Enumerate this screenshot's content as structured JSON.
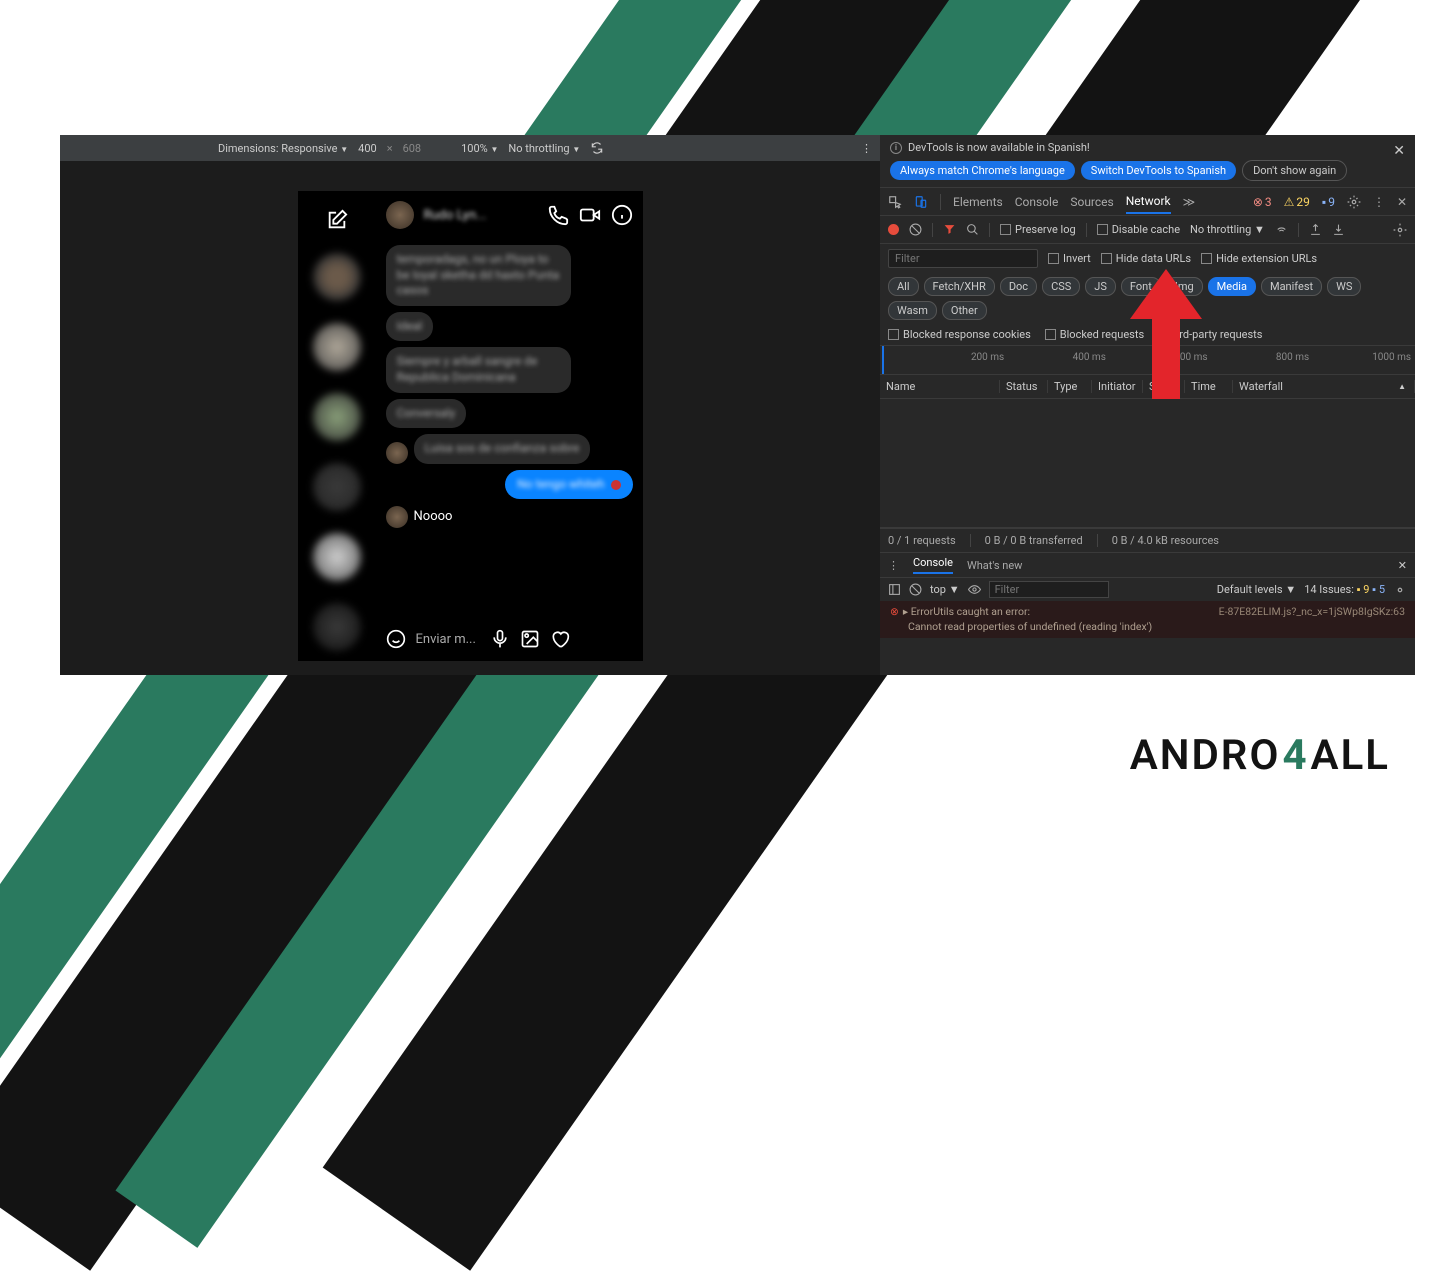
{
  "devtools_banner": {
    "message": "DevTools is now available in Spanish!",
    "btn_match": "Always match Chrome's language",
    "btn_switch": "Switch DevTools to Spanish",
    "btn_dismiss": "Don't show again"
  },
  "device_toolbar": {
    "dimensions_label": "Dimensions: Responsive",
    "width": "400",
    "x": "×",
    "height": "608",
    "zoom": "100%",
    "throttling": "No throttling"
  },
  "chat": {
    "header_name": "Rudo Lyn...",
    "msg_blur1": "temporadags, no un Ploya to be loyal sketha dd haxto Punta casos",
    "msg_blur2": "Ideal",
    "msg_blur3": "Siempre y arball sangre de Republica Dominicana",
    "msg_blur4": "Conversaly",
    "msg_blur5": "Luisa sos de confianza sobre",
    "msg_out_blur": "No tengo whiteh",
    "msg_noooo": "Noooo",
    "composer_placeholder": "Enviar m..."
  },
  "devtools_tabs": {
    "elements": "Elements",
    "console": "Console",
    "sources": "Sources",
    "network": "Network",
    "err_count": "3",
    "warn_count": "29",
    "info_count": "9"
  },
  "network_toolbar": {
    "preserve": "Preserve log",
    "disable_cache": "Disable cache",
    "throttling": "No throttling"
  },
  "filter": {
    "placeholder": "Filter",
    "invert": "Invert",
    "hide_data": "Hide data URLs",
    "hide_ext": "Hide extension URLs"
  },
  "type_filters": [
    "All",
    "Fetch/XHR",
    "Doc",
    "CSS",
    "JS",
    "Font",
    "Img",
    "Media",
    "Manifest",
    "WS",
    "Wasm",
    "Other"
  ],
  "type_active_index": 7,
  "secondary_filters": {
    "blocked_cookies": "Blocked response cookies",
    "blocked_requests": "Blocked requests",
    "third_party": "3rd-party requests"
  },
  "timeline_ticks": [
    "200 ms",
    "400 ms",
    "600 ms",
    "800 ms",
    "1000 ms"
  ],
  "net_columns": [
    "Name",
    "Status",
    "Type",
    "Initiator",
    "Size",
    "Time",
    "Waterfall"
  ],
  "status_bar": {
    "requests": "0 / 1 requests",
    "transferred": "0 B / 0 B transferred",
    "resources": "0 B / 4.0 kB resources"
  },
  "console_tabs": {
    "console": "Console",
    "whats_new": "What's new"
  },
  "console_toolbar": {
    "context": "top",
    "filter_placeholder": "Filter",
    "levels": "Default levels",
    "issues_label": "14 Issues:",
    "issues_orange": "9",
    "issues_blue": "5"
  },
  "console_output": {
    "line1": "▸ ErrorUtils caught an error:",
    "src1": "E-87E82ELIM.js?_nc_x=1jSWp8IgSKz:63",
    "line2": "Cannot read properties of undefined (reading 'index')"
  },
  "brand": {
    "p1": "ANDRO",
    "four": "4",
    "p2": "ALL"
  }
}
